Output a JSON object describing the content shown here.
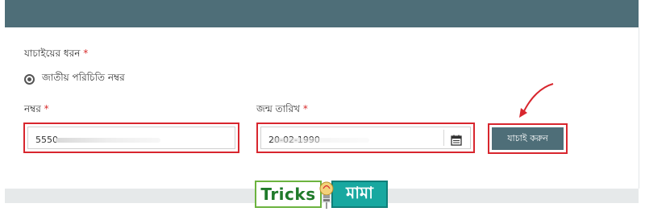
{
  "form": {
    "verification_type_label": "যাচাইয়ের ধরন",
    "required_mark": "*",
    "radio_option_label": "জাতীয় পরিচিতি নম্বর",
    "number_label": "নম্বর",
    "number_value": "5550",
    "dob_label": "জন্ম তারিখ",
    "dob_value": "20-02-1990",
    "verify_button_label": "যাচাই করুন"
  },
  "watermark": {
    "part1": "Tricks",
    "part2": "মামা"
  },
  "icons": {
    "radio": "radio-selected-icon",
    "calendar": "calendar-icon",
    "arrow": "red-arrow-icon",
    "bulb": "lightbulb-icon"
  },
  "colors": {
    "header": "#4e6e78",
    "highlight": "#d8262e",
    "button": "#4e6e78",
    "watermark_green": "#1f7a2a",
    "watermark_teal": "#18a8a0"
  }
}
